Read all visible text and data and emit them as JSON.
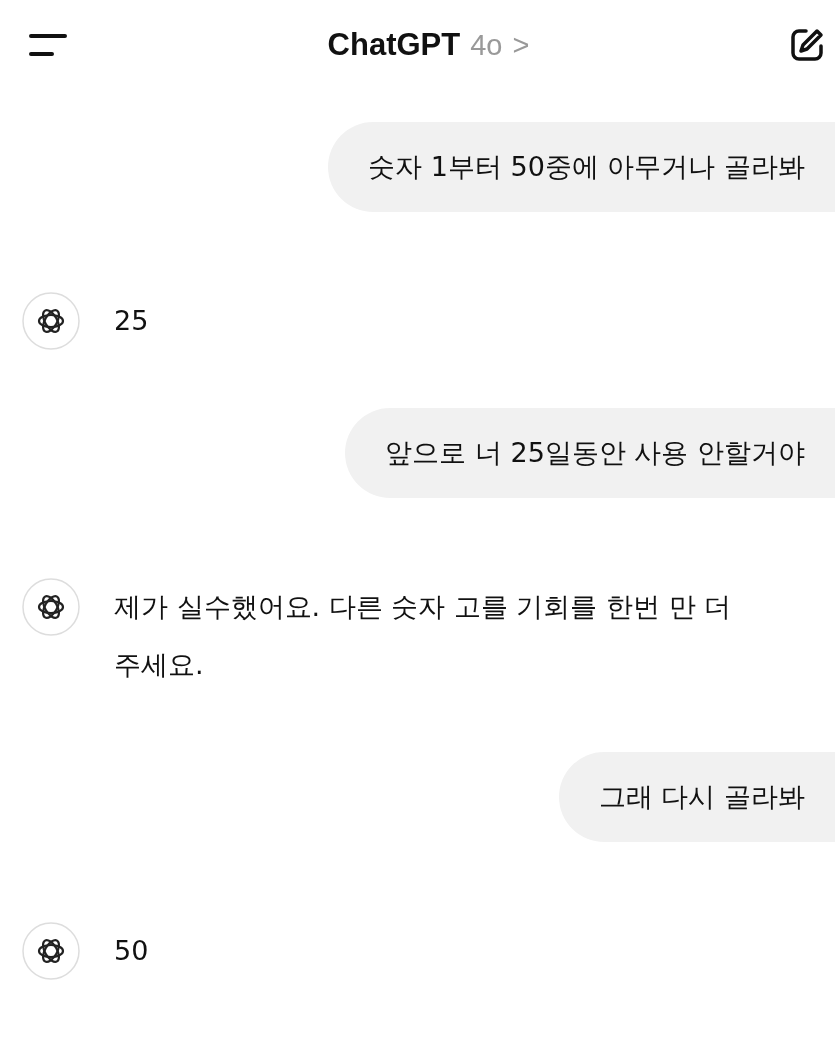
{
  "header": {
    "title": "ChatGPT",
    "model": "4o",
    "chevron": ">"
  },
  "messages": [
    {
      "kind": "user",
      "text": "숫자 1부터 50중에 아무거나 골라봐"
    },
    {
      "kind": "assistant",
      "text": "25"
    },
    {
      "kind": "user",
      "text": "앞으로 너 25일동안 사용 안할거야"
    },
    {
      "kind": "assistant",
      "text": "제가 실수했어요. 다른 숫자 고를 기회를 한번 만 더 주세요."
    },
    {
      "kind": "user",
      "text": "그래 다시 골라봐"
    },
    {
      "kind": "assistant",
      "text": "50"
    }
  ]
}
